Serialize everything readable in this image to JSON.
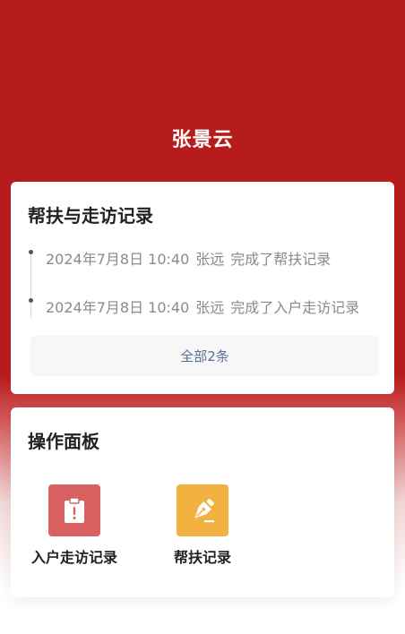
{
  "header": {
    "name": "张景云"
  },
  "records": {
    "title": "帮扶与走访记录",
    "items": [
      {
        "time": "2024年7月8日 10:40",
        "person": "张远",
        "action": "完成了帮扶记录"
      },
      {
        "time": "2024年7月8日 10:40",
        "person": "张远",
        "action": "完成了入户走访记录"
      }
    ],
    "all_label": "全部2条"
  },
  "panel": {
    "title": "操作面板",
    "actions": [
      {
        "label": "入户走访记录",
        "icon": "clipboard-alert-icon",
        "color": "#d96060"
      },
      {
        "label": "帮扶记录",
        "icon": "pen-nib-icon",
        "color": "#f2b140"
      }
    ]
  },
  "colors": {
    "header_bg": "#b71c1c",
    "link": "#5a6e94"
  }
}
